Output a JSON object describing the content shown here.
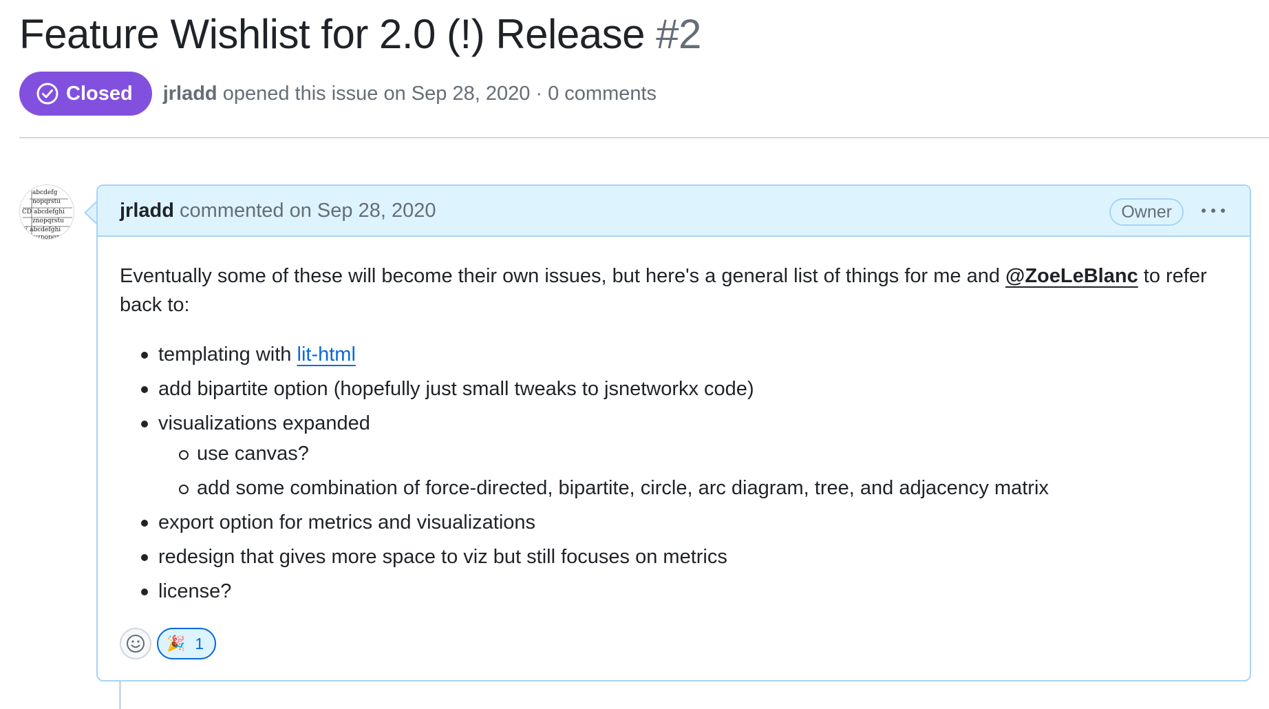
{
  "issue": {
    "title": "Feature Wishlist for 2.0 (!) Release",
    "number": "#2",
    "state_label": "Closed",
    "state_color": "#8250df",
    "author": "jrladd",
    "meta_suffix": "opened this issue on Sep 28, 2020 · 0 comments"
  },
  "comment": {
    "author": "jrladd",
    "action_text": "commented on Sep 28, 2020",
    "role_badge": "Owner",
    "intro_before": "Eventually some of these will become their own issues, but here's a general list of things for me and",
    "mention": "@ZoeLeBlanc",
    "intro_after": "to refer back to:",
    "items": [
      {
        "text": "templating with",
        "link": "lit-html"
      },
      {
        "text": "add bipartite option (hopefully just small tweaks to jsnetworkx code)"
      },
      {
        "text": "visualizations expanded",
        "subitems": [
          "use canvas?",
          "add some combination of force-directed, bipartite, circle, arc diagram, tree, and adjacency matrix"
        ]
      },
      {
        "text": "export option for metrics and visualizations"
      },
      {
        "text": "redesign that gives more space to viz but still focuses on metrics"
      },
      {
        "text": "license?"
      }
    ],
    "reactions": [
      {
        "emoji": "🎉",
        "icon": "tada-icon",
        "count": "1"
      }
    ]
  },
  "avatar_text": [
    "abcdefg",
    "nopqrstu",
    "CD abcdefghi",
    "znopqrstu",
    "F abcdefghi",
    "yznopqr"
  ],
  "colors": {
    "accent_blue": "#0969da",
    "comment_header_bg": "#ddf4ff",
    "comment_border": "#a8d3f5",
    "muted_text": "#656d76"
  },
  "icons": {
    "state": "issue-closed-icon",
    "add_reaction": "smiley-icon",
    "menu": "kebab-horizontal-icon"
  }
}
